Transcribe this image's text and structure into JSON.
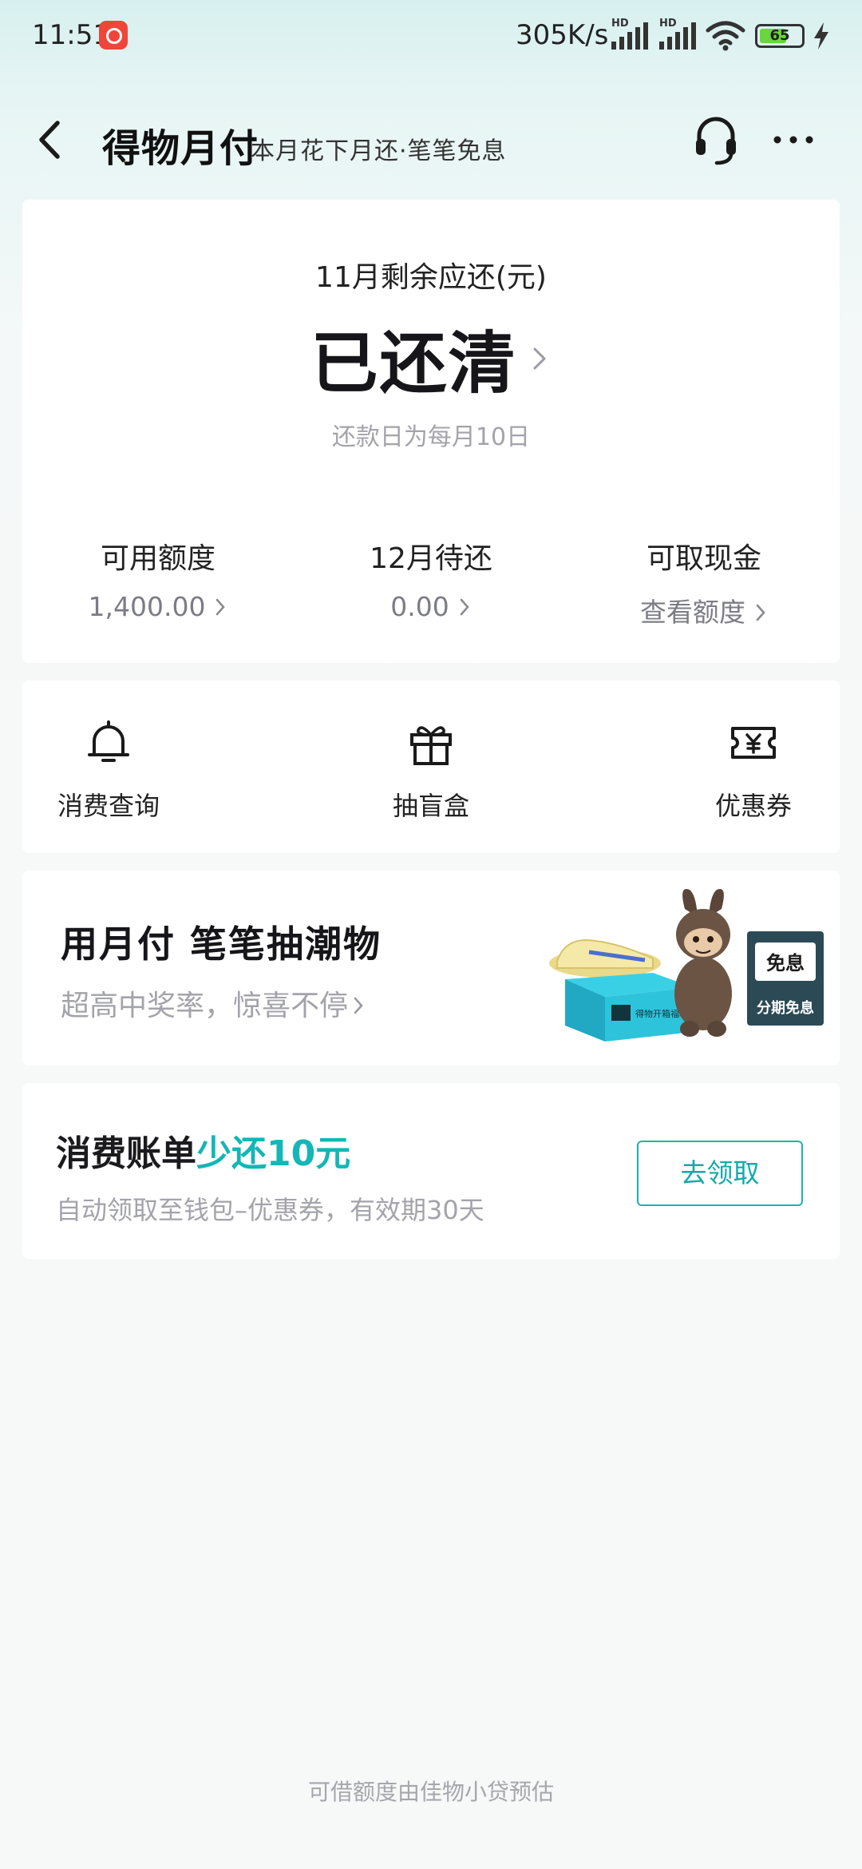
{
  "status_bar": {
    "time": "11:51",
    "network_speed": "305K/s",
    "signal_tag_1": "HD",
    "signal_tag_2": "HD",
    "battery": "65",
    "battery_level": 0.65,
    "app_icon": "netease-music-icon"
  },
  "header": {
    "brand": "得物月付",
    "slogan": "本月花下月还·笔笔免息",
    "icons": {
      "back": "back-arrow-icon",
      "service": "headset-icon",
      "more": "more-dots-icon"
    }
  },
  "bill": {
    "title": "11月剩余应还(元)",
    "status": "已还清",
    "repay_day": "还款日为每月10日",
    "stats": [
      {
        "label": "可用额度",
        "value": "1,400.00"
      },
      {
        "label": "12月待还",
        "value": "0.00"
      },
      {
        "label": "可取现金",
        "value": "查看额度"
      }
    ]
  },
  "quick_actions": [
    {
      "label": "消费查询",
      "icon": "bell-icon"
    },
    {
      "label": "抽盲盒",
      "icon": "gift-icon"
    },
    {
      "label": "优惠券",
      "icon": "coupon-yen-icon"
    }
  ],
  "promo": {
    "title": "用月付 笔笔抽潮物",
    "subtitle": "超高中奖率，惊喜不停",
    "art": {
      "badge": "免息",
      "tag": "分期免息",
      "box_text": "得物开箱福利"
    }
  },
  "coupon": {
    "title_prefix": "消费账单",
    "title_highlight": "少还10元",
    "subtitle": "自动领取至钱包–优惠券，有效期30天",
    "button": "去领取",
    "accent": "#14b6b6"
  },
  "footer": {
    "note": "可借额度由佳物小贷预估"
  }
}
